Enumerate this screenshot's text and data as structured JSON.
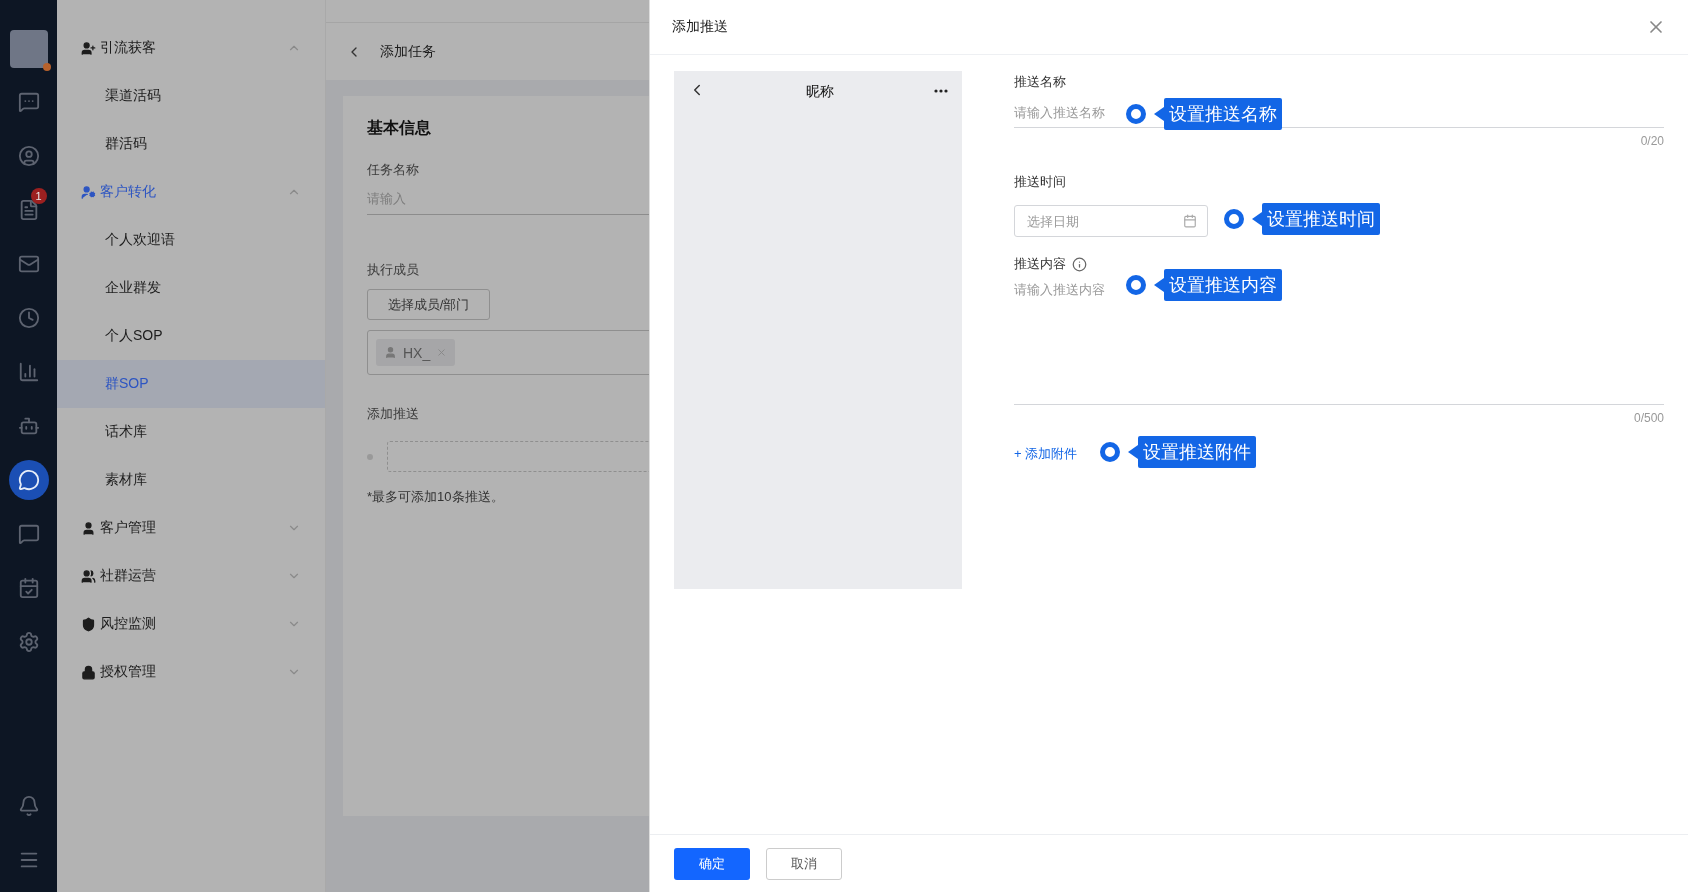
{
  "icon_rail": {
    "items": [
      {
        "kind": "chat",
        "selected": false
      },
      {
        "kind": "user",
        "selected": false
      },
      {
        "kind": "doc",
        "selected": false,
        "badge": "1"
      },
      {
        "kind": "mail",
        "selected": false
      },
      {
        "kind": "clock",
        "selected": false
      },
      {
        "kind": "chart",
        "selected": false
      },
      {
        "kind": "robot",
        "selected": false
      },
      {
        "kind": "wecom",
        "selected": true
      },
      {
        "kind": "message",
        "selected": false
      },
      {
        "kind": "calendar",
        "selected": false
      },
      {
        "kind": "settings",
        "selected": false
      }
    ],
    "bottom": [
      {
        "kind": "bell",
        "selected": false
      },
      {
        "kind": "menu",
        "selected": false
      }
    ]
  },
  "menu": [
    {
      "label": "引流获客",
      "kind": "user-plus",
      "expanded": true,
      "selected": false,
      "children": [
        {
          "label": "渠道活码",
          "selected": false
        },
        {
          "label": "群活码",
          "selected": false
        }
      ]
    },
    {
      "label": "客户转化",
      "kind": "user-cog",
      "expanded": true,
      "selected": true,
      "children": [
        {
          "label": "个人欢迎语",
          "selected": false
        },
        {
          "label": "企业群发",
          "selected": false
        },
        {
          "label": "个人SOP",
          "selected": false
        },
        {
          "label": "群SOP",
          "selected": true
        },
        {
          "label": "话术库",
          "selected": false
        },
        {
          "label": "素材库",
          "selected": false
        }
      ]
    },
    {
      "label": "客户管理",
      "kind": "user",
      "expanded": false,
      "selected": false
    },
    {
      "label": "社群运营",
      "kind": "users",
      "expanded": false,
      "selected": false
    },
    {
      "label": "风控监测",
      "kind": "shield",
      "expanded": false,
      "selected": false
    },
    {
      "label": "授权管理",
      "kind": "lock",
      "expanded": false,
      "selected": false
    }
  ],
  "page": {
    "title": "添加任务",
    "section_title": "基本信息",
    "task_name": {
      "label": "任务名称",
      "placeholder": "请输入"
    },
    "members": {
      "label": "执行成员",
      "button": "选择成员/部门",
      "tags": [
        "HX_"
      ]
    },
    "push": {
      "label": "添加推送",
      "note": "*最多可添加10条推送。"
    }
  },
  "drawer": {
    "title": "添加推送",
    "preview": {
      "title": "昵称"
    },
    "name_field": {
      "label": "推送名称",
      "placeholder": "请输入推送名称",
      "counter": "0/20",
      "callout": "设置推送名称"
    },
    "time_field": {
      "label": "推送时间",
      "placeholder": "选择日期",
      "callout": "设置推送时间"
    },
    "content_field": {
      "label": "推送内容",
      "placeholder": "请输入推送内容",
      "counter": "0/500",
      "callout": "设置推送内容"
    },
    "attachment": {
      "label": "+ 添加附件",
      "callout": "设置推送附件"
    },
    "buttons": [
      {
        "label": "确定",
        "kind": "primary"
      },
      {
        "label": "取消",
        "kind": "default"
      }
    ]
  }
}
